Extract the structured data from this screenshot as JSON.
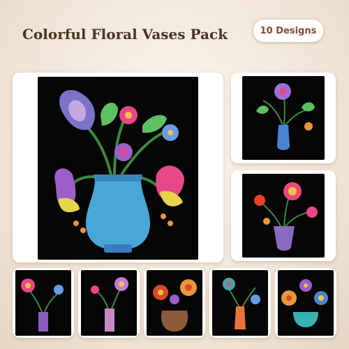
{
  "header": {
    "title": "Colorful Floral Vases Pack",
    "badge_label": "10 Designs"
  },
  "colors": {
    "background": "#f3e9dd",
    "title_text": "#4a3426",
    "badge_text": "#8a4a2e",
    "artwork_background": "#060606"
  },
  "designs": [
    {
      "name": "blue-vase-lilies-design",
      "icon": "blue-vase-icon"
    },
    {
      "name": "blue-bud-vase-design",
      "icon": "bud-vase-icon"
    },
    {
      "name": "lavender-vase-bouquet-design",
      "icon": "lavender-vase-icon"
    },
    {
      "name": "purple-tall-vase-design",
      "icon": "tall-vase-icon"
    },
    {
      "name": "pink-cylinder-vase-design",
      "icon": "cylinder-vase-icon"
    },
    {
      "name": "brown-bowl-vase-design",
      "icon": "bowl-vase-icon"
    },
    {
      "name": "orange-bottle-vase-design",
      "icon": "bottle-vase-icon"
    },
    {
      "name": "teal-bowl-vase-design",
      "icon": "teal-bowl-icon"
    }
  ]
}
